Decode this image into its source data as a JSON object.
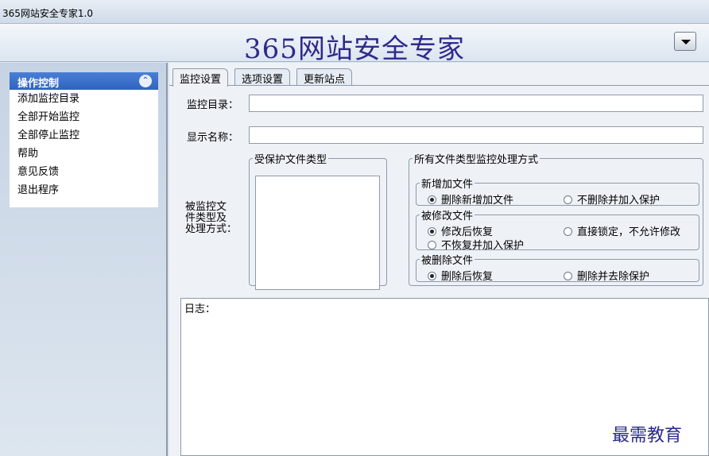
{
  "window": {
    "title": "365网站安全专家1.0"
  },
  "header": {
    "app_name": "365网站安全专家",
    "menu_icon": "dropdown-arrow-icon"
  },
  "sidebar": {
    "panel_title": "操作控制",
    "collapse_icon": "double-chevron-up-icon",
    "items": [
      {
        "label": "添加监控目录"
      },
      {
        "label": "全部开始监控"
      },
      {
        "label": "全部停止监控"
      },
      {
        "label": "帮助"
      },
      {
        "label": "意见反馈"
      },
      {
        "label": "退出程序"
      }
    ]
  },
  "tabs": [
    {
      "label": "监控设置",
      "active": true
    },
    {
      "label": "选项设置",
      "active": false
    },
    {
      "label": "更新站点",
      "active": false
    }
  ],
  "form": {
    "monitor_dir_label": "监控目录：",
    "monitor_dir_value": "",
    "display_name_label": "显示名称：",
    "display_name_value": "",
    "file_type_label_lines": [
      "被监控文",
      "件类型及",
      "处理方式："
    ]
  },
  "protected_types": {
    "legend": "受保护文件类型",
    "items": []
  },
  "handling": {
    "legend": "所有文件类型监控处理方式",
    "new_files": {
      "legend": "新增加文件",
      "options": [
        {
          "label": "删除新增加文件",
          "selected": true
        },
        {
          "label": "不删除并加入保护",
          "selected": false
        }
      ]
    },
    "modified_files": {
      "legend": "被修改文件",
      "options": [
        {
          "label": "修改后恢复",
          "selected": true
        },
        {
          "label": "直接锁定，不允许修改",
          "selected": false
        },
        {
          "label": "不恢复并加入保护",
          "selected": false
        }
      ]
    },
    "deleted_files": {
      "legend": "被删除文件",
      "options": [
        {
          "label": "删除后恢复",
          "selected": true
        },
        {
          "label": "删除并去除保护",
          "selected": false
        }
      ]
    }
  },
  "log": {
    "label": "日志："
  },
  "watermark": "最需教育"
}
